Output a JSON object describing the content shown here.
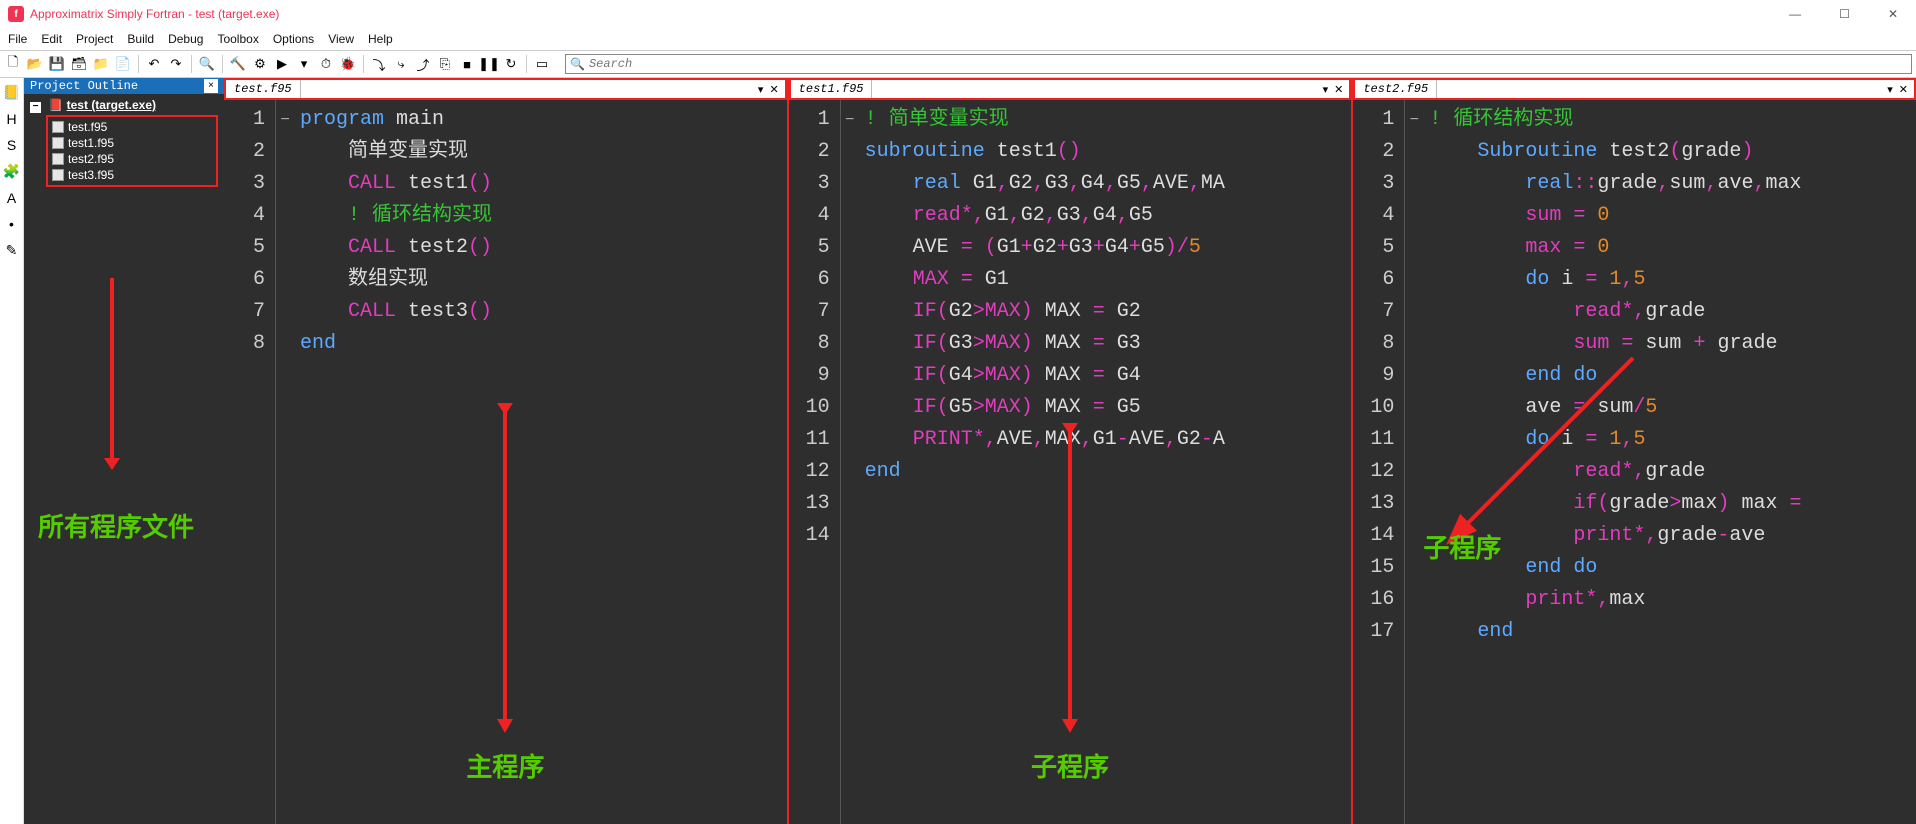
{
  "window": {
    "title": "Approximatrix Simply Fortran - test (target.exe)",
    "icon_letter": "f"
  },
  "menu": [
    "File",
    "Edit",
    "Project",
    "Build",
    "Debug",
    "Toolbox",
    "Options",
    "View",
    "Help"
  ],
  "toolbar": {
    "buttons": [
      {
        "name": "new-file-icon",
        "glyph": "🗋"
      },
      {
        "name": "open-icon",
        "glyph": "📂"
      },
      {
        "name": "save-icon",
        "glyph": "💾"
      },
      {
        "name": "save-all-icon",
        "glyph": "🗃"
      },
      {
        "name": "folder-gear-icon",
        "glyph": "📁"
      },
      {
        "name": "wizard-icon",
        "glyph": "📄"
      },
      {
        "name": "sep"
      },
      {
        "name": "undo-icon",
        "glyph": "↶"
      },
      {
        "name": "redo-icon",
        "glyph": "↷"
      },
      {
        "name": "sep"
      },
      {
        "name": "search-icon",
        "glyph": "🔍"
      },
      {
        "name": "sep"
      },
      {
        "name": "hammer-icon",
        "glyph": "🔨"
      },
      {
        "name": "gear-icon",
        "glyph": "⚙"
      },
      {
        "name": "run-icon",
        "glyph": "▶"
      },
      {
        "name": "run-dropdown-icon",
        "glyph": "▾"
      },
      {
        "name": "clock-icon",
        "glyph": "⏱"
      },
      {
        "name": "bug-icon",
        "glyph": "🐞"
      },
      {
        "name": "sep"
      },
      {
        "name": "step-over-icon",
        "glyph": "⤵"
      },
      {
        "name": "step-into-icon",
        "glyph": "⤷"
      },
      {
        "name": "step-out-icon",
        "glyph": "⤴"
      },
      {
        "name": "cursor-icon",
        "glyph": "⎘"
      },
      {
        "name": "stop-icon",
        "glyph": "■"
      },
      {
        "name": "pause-icon",
        "glyph": "❚❚"
      },
      {
        "name": "restart-icon",
        "glyph": "↻"
      },
      {
        "name": "sep"
      },
      {
        "name": "term-icon",
        "glyph": "▭"
      }
    ],
    "search_placeholder": "Search"
  },
  "left_icons": [
    {
      "name": "book-icon",
      "glyph": "📒"
    },
    {
      "name": "hf-icon",
      "glyph": "H"
    },
    {
      "name": "sub-icon",
      "glyph": "S"
    },
    {
      "name": "puzzle-icon",
      "glyph": "🧩"
    },
    {
      "name": "abc-icon",
      "glyph": "A"
    },
    {
      "name": "bullet-icon",
      "glyph": "•"
    },
    {
      "name": "pencil-icon",
      "glyph": "✎"
    }
  ],
  "outline": {
    "title": "Project Outline",
    "root": "test (target.exe)",
    "files": [
      "test.f95",
      "test1.f95",
      "test2.f95",
      "test3.f95"
    ]
  },
  "annotations": {
    "sidebar_label": "所有程序文件",
    "pane1_label": "主程序",
    "pane2_label": "子程序",
    "pane3_label": "子程序"
  },
  "panes": [
    {
      "tab": "test.f95",
      "lines": [
        [
          {
            "cls": "kw",
            "t": "program"
          },
          {
            "cls": "pn",
            "t": " "
          },
          {
            "cls": "id",
            "t": "main"
          }
        ],
        [
          {
            "cls": "pn",
            "t": "    简单变量实现"
          }
        ],
        [
          {
            "cls": "pn",
            "t": "    "
          },
          {
            "cls": "kw2",
            "t": "CALL"
          },
          {
            "cls": "pn",
            "t": " test1"
          },
          {
            "cls": "kw2",
            "t": "()"
          }
        ],
        [
          {
            "cls": "pn",
            "t": "    "
          },
          {
            "cls": "cm",
            "t": "! 循环结构实现"
          }
        ],
        [
          {
            "cls": "pn",
            "t": "    "
          },
          {
            "cls": "kw2",
            "t": "CALL"
          },
          {
            "cls": "pn",
            "t": " test2"
          },
          {
            "cls": "kw2",
            "t": "()"
          }
        ],
        [
          {
            "cls": "pn",
            "t": "    数组实现"
          }
        ],
        [
          {
            "cls": "pn",
            "t": "    "
          },
          {
            "cls": "kw2",
            "t": "CALL"
          },
          {
            "cls": "pn",
            "t": " test3"
          },
          {
            "cls": "kw2",
            "t": "()"
          }
        ],
        [
          {
            "cls": "kw",
            "t": "end"
          }
        ]
      ],
      "fold_lines": [
        1
      ]
    },
    {
      "tab": "test1.f95",
      "lines": [
        [
          {
            "cls": "cm",
            "t": "! 简单变量实现"
          }
        ],
        [
          {
            "cls": "kw",
            "t": "subroutine"
          },
          {
            "cls": "pn",
            "t": " test1"
          },
          {
            "cls": "kw2",
            "t": "()"
          }
        ],
        [
          {
            "cls": "pn",
            "t": "    "
          },
          {
            "cls": "kw",
            "t": "real"
          },
          {
            "cls": "pn",
            "t": " G1"
          },
          {
            "cls": "kw2",
            "t": ","
          },
          {
            "cls": "pn",
            "t": "G2"
          },
          {
            "cls": "kw2",
            "t": ","
          },
          {
            "cls": "pn",
            "t": "G3"
          },
          {
            "cls": "kw2",
            "t": ","
          },
          {
            "cls": "pn",
            "t": "G4"
          },
          {
            "cls": "kw2",
            "t": ","
          },
          {
            "cls": "pn",
            "t": "G5"
          },
          {
            "cls": "kw2",
            "t": ","
          },
          {
            "cls": "pn",
            "t": "AVE"
          },
          {
            "cls": "kw2",
            "t": ","
          },
          {
            "cls": "pn",
            "t": "MA"
          }
        ],
        [
          {
            "cls": "pn",
            "t": "    "
          },
          {
            "cls": "kw2",
            "t": "read*,"
          },
          {
            "cls": "pn",
            "t": "G1"
          },
          {
            "cls": "kw2",
            "t": ","
          },
          {
            "cls": "pn",
            "t": "G2"
          },
          {
            "cls": "kw2",
            "t": ","
          },
          {
            "cls": "pn",
            "t": "G3"
          },
          {
            "cls": "kw2",
            "t": ","
          },
          {
            "cls": "pn",
            "t": "G4"
          },
          {
            "cls": "kw2",
            "t": ","
          },
          {
            "cls": "pn",
            "t": "G5"
          }
        ],
        [
          {
            "cls": "pn",
            "t": ""
          }
        ],
        [
          {
            "cls": "pn",
            "t": "    AVE "
          },
          {
            "cls": "kw2",
            "t": "="
          },
          {
            "cls": "pn",
            "t": " "
          },
          {
            "cls": "kw2",
            "t": "("
          },
          {
            "cls": "pn",
            "t": "G1"
          },
          {
            "cls": "kw2",
            "t": "+"
          },
          {
            "cls": "pn",
            "t": "G2"
          },
          {
            "cls": "kw2",
            "t": "+"
          },
          {
            "cls": "pn",
            "t": "G3"
          },
          {
            "cls": "kw2",
            "t": "+"
          },
          {
            "cls": "pn",
            "t": "G4"
          },
          {
            "cls": "kw2",
            "t": "+"
          },
          {
            "cls": "pn",
            "t": "G5"
          },
          {
            "cls": "kw2",
            "t": ")/"
          },
          {
            "cls": "num",
            "t": "5"
          }
        ],
        [
          {
            "cls": "pn",
            "t": "    "
          },
          {
            "cls": "kw2",
            "t": "MAX"
          },
          {
            "cls": "pn",
            "t": " "
          },
          {
            "cls": "kw2",
            "t": "="
          },
          {
            "cls": "pn",
            "t": " G1"
          }
        ],
        [
          {
            "cls": "pn",
            "t": "    "
          },
          {
            "cls": "kw2",
            "t": "IF("
          },
          {
            "cls": "pn",
            "t": "G2"
          },
          {
            "cls": "kw2",
            "t": ">MAX)"
          },
          {
            "cls": "pn",
            "t": " MAX "
          },
          {
            "cls": "kw2",
            "t": "="
          },
          {
            "cls": "pn",
            "t": " G2"
          }
        ],
        [
          {
            "cls": "pn",
            "t": "    "
          },
          {
            "cls": "kw2",
            "t": "IF("
          },
          {
            "cls": "pn",
            "t": "G3"
          },
          {
            "cls": "kw2",
            "t": ">MAX)"
          },
          {
            "cls": "pn",
            "t": " MAX "
          },
          {
            "cls": "kw2",
            "t": "="
          },
          {
            "cls": "pn",
            "t": " G3"
          }
        ],
        [
          {
            "cls": "pn",
            "t": "    "
          },
          {
            "cls": "kw2",
            "t": "IF("
          },
          {
            "cls": "pn",
            "t": "G4"
          },
          {
            "cls": "kw2",
            "t": ">MAX)"
          },
          {
            "cls": "pn",
            "t": " MAX "
          },
          {
            "cls": "kw2",
            "t": "="
          },
          {
            "cls": "pn",
            "t": " G4"
          }
        ],
        [
          {
            "cls": "pn",
            "t": "    "
          },
          {
            "cls": "kw2",
            "t": "IF("
          },
          {
            "cls": "pn",
            "t": "G5"
          },
          {
            "cls": "kw2",
            "t": ">MAX)"
          },
          {
            "cls": "pn",
            "t": " MAX "
          },
          {
            "cls": "kw2",
            "t": "="
          },
          {
            "cls": "pn",
            "t": " G5"
          }
        ],
        [
          {
            "cls": "pn",
            "t": "    "
          },
          {
            "cls": "kw2",
            "t": "PRINT*,"
          },
          {
            "cls": "pn",
            "t": "AVE"
          },
          {
            "cls": "kw2",
            "t": ","
          },
          {
            "cls": "pn",
            "t": "MAX"
          },
          {
            "cls": "kw2",
            "t": ","
          },
          {
            "cls": "pn",
            "t": "G1"
          },
          {
            "cls": "kw2",
            "t": "-"
          },
          {
            "cls": "pn",
            "t": "AVE"
          },
          {
            "cls": "kw2",
            "t": ","
          },
          {
            "cls": "pn",
            "t": "G2"
          },
          {
            "cls": "kw2",
            "t": "-"
          },
          {
            "cls": "pn",
            "t": "A"
          }
        ],
        [
          {
            "cls": "kw",
            "t": "end"
          }
        ],
        [
          {
            "cls": "pn",
            "t": ""
          }
        ]
      ],
      "fold_lines": [
        2
      ]
    },
    {
      "tab": "test2.f95",
      "lines": [
        [
          {
            "cls": "cm",
            "t": "! 循环结构实现"
          }
        ],
        [
          {
            "cls": "pn",
            "t": "    "
          },
          {
            "cls": "kw",
            "t": "Subroutine"
          },
          {
            "cls": "pn",
            "t": " test2"
          },
          {
            "cls": "kw2",
            "t": "("
          },
          {
            "cls": "pn",
            "t": "grade"
          },
          {
            "cls": "kw2",
            "t": ")"
          }
        ],
        [
          {
            "cls": "pn",
            "t": "        "
          },
          {
            "cls": "kw",
            "t": "real"
          },
          {
            "cls": "kw2",
            "t": "::"
          },
          {
            "cls": "pn",
            "t": "grade"
          },
          {
            "cls": "kw2",
            "t": ","
          },
          {
            "cls": "pn",
            "t": "sum"
          },
          {
            "cls": "kw2",
            "t": ","
          },
          {
            "cls": "pn",
            "t": "ave"
          },
          {
            "cls": "kw2",
            "t": ","
          },
          {
            "cls": "pn",
            "t": "max"
          }
        ],
        [
          {
            "cls": "pn",
            "t": "        "
          },
          {
            "cls": "kw2",
            "t": "sum"
          },
          {
            "cls": "pn",
            "t": " "
          },
          {
            "cls": "kw2",
            "t": "="
          },
          {
            "cls": "pn",
            "t": " "
          },
          {
            "cls": "num",
            "t": "0"
          }
        ],
        [
          {
            "cls": "pn",
            "t": "        "
          },
          {
            "cls": "kw2",
            "t": "max"
          },
          {
            "cls": "pn",
            "t": " "
          },
          {
            "cls": "kw2",
            "t": "="
          },
          {
            "cls": "pn",
            "t": " "
          },
          {
            "cls": "num",
            "t": "0"
          }
        ],
        [
          {
            "cls": "pn",
            "t": "        "
          },
          {
            "cls": "kw",
            "t": "do"
          },
          {
            "cls": "pn",
            "t": " i "
          },
          {
            "cls": "kw2",
            "t": "="
          },
          {
            "cls": "pn",
            "t": " "
          },
          {
            "cls": "num",
            "t": "1"
          },
          {
            "cls": "kw2",
            "t": ","
          },
          {
            "cls": "num",
            "t": "5"
          }
        ],
        [
          {
            "cls": "pn",
            "t": "            "
          },
          {
            "cls": "kw2",
            "t": "read*,"
          },
          {
            "cls": "pn",
            "t": "grade"
          }
        ],
        [
          {
            "cls": "pn",
            "t": "            "
          },
          {
            "cls": "kw2",
            "t": "sum"
          },
          {
            "cls": "pn",
            "t": " "
          },
          {
            "cls": "kw2",
            "t": "="
          },
          {
            "cls": "pn",
            "t": " sum "
          },
          {
            "cls": "kw2",
            "t": "+"
          },
          {
            "cls": "pn",
            "t": " grade"
          }
        ],
        [
          {
            "cls": "pn",
            "t": "        "
          },
          {
            "cls": "kw",
            "t": "end do"
          }
        ],
        [
          {
            "cls": "pn",
            "t": "        ave "
          },
          {
            "cls": "kw2",
            "t": "="
          },
          {
            "cls": "pn",
            "t": " sum"
          },
          {
            "cls": "kw2",
            "t": "/"
          },
          {
            "cls": "num",
            "t": "5"
          }
        ],
        [
          {
            "cls": "pn",
            "t": "        "
          },
          {
            "cls": "kw",
            "t": "do"
          },
          {
            "cls": "pn",
            "t": " i "
          },
          {
            "cls": "kw2",
            "t": "="
          },
          {
            "cls": "pn",
            "t": " "
          },
          {
            "cls": "num",
            "t": "1"
          },
          {
            "cls": "kw2",
            "t": ","
          },
          {
            "cls": "num",
            "t": "5"
          }
        ],
        [
          {
            "cls": "pn",
            "t": "            "
          },
          {
            "cls": "kw2",
            "t": "read*,"
          },
          {
            "cls": "pn",
            "t": "grade"
          }
        ],
        [
          {
            "cls": "pn",
            "t": "            "
          },
          {
            "cls": "kw2",
            "t": "if("
          },
          {
            "cls": "pn",
            "t": "grade"
          },
          {
            "cls": "kw2",
            "t": ">"
          },
          {
            "cls": "pn",
            "t": "max"
          },
          {
            "cls": "kw2",
            "t": ")"
          },
          {
            "cls": "pn",
            "t": " max "
          },
          {
            "cls": "kw2",
            "t": "="
          }
        ],
        [
          {
            "cls": "pn",
            "t": "            "
          },
          {
            "cls": "kw2",
            "t": "print*,"
          },
          {
            "cls": "pn",
            "t": "grade"
          },
          {
            "cls": "kw2",
            "t": "-"
          },
          {
            "cls": "pn",
            "t": "ave"
          }
        ],
        [
          {
            "cls": "pn",
            "t": "        "
          },
          {
            "cls": "kw",
            "t": "end do"
          }
        ],
        [
          {
            "cls": "pn",
            "t": "        "
          },
          {
            "cls": "kw2",
            "t": "print*,"
          },
          {
            "cls": "pn",
            "t": "max"
          }
        ],
        [
          {
            "cls": "pn",
            "t": "    "
          },
          {
            "cls": "kw",
            "t": "end"
          }
        ]
      ],
      "fold_lines": [
        2
      ]
    }
  ]
}
